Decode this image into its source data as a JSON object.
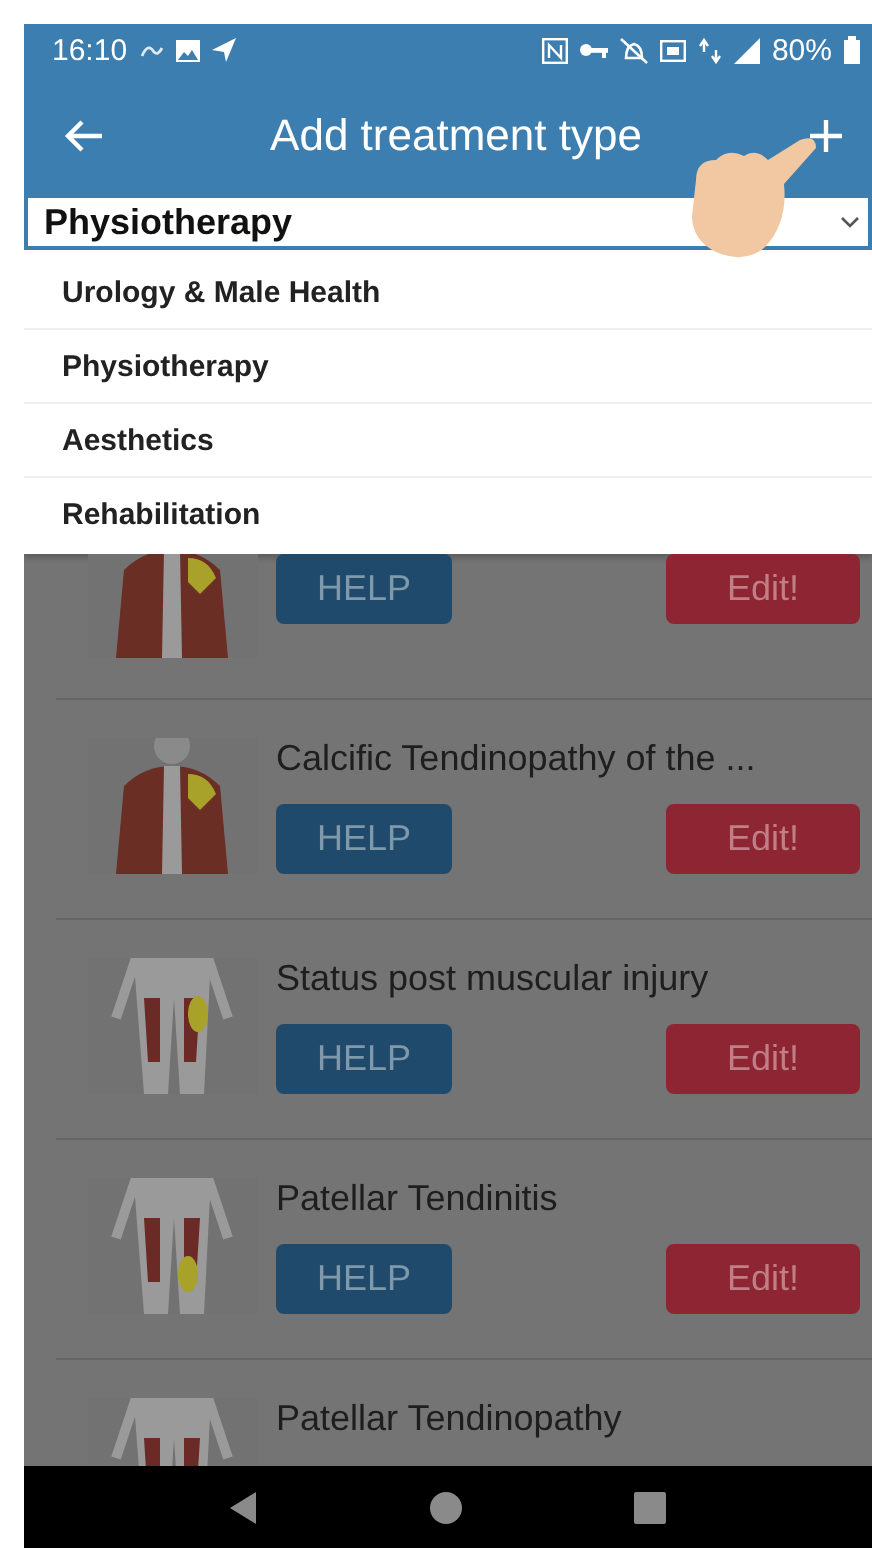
{
  "status_bar": {
    "time": "16:10",
    "battery": "80%"
  },
  "app_bar": {
    "title": "Add treatment type"
  },
  "select": {
    "value": "Physiotherapy"
  },
  "dropdown": {
    "options": [
      {
        "label": "Urology & Male Health"
      },
      {
        "label": "Physiotherapy"
      },
      {
        "label": "Aesthetics"
      },
      {
        "label": "Rehabilitation"
      }
    ]
  },
  "treatments": [
    {
      "kind": "picture",
      "help": "HELP",
      "edit": "Edit!"
    },
    {
      "kind": "picture",
      "title": "Calcific Tendinopathy of the ...",
      "help": "HELP",
      "edit": "Edit!"
    },
    {
      "kind": "picture",
      "title": "Status post muscular injury",
      "help": "HELP",
      "edit": "Edit!"
    },
    {
      "kind": "picture",
      "title": "Patellar Tendinitis",
      "help": "HELP",
      "edit": "Edit!"
    },
    {
      "kind": "picture",
      "title": "Patellar Tendinopathy"
    }
  ]
}
